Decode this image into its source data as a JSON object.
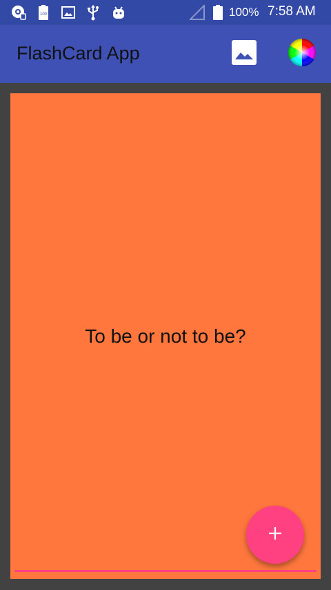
{
  "status_bar": {
    "battery_percent": "100%",
    "time": "7:58 AM",
    "icons": [
      "sync-music-icon",
      "battery-saver-icon",
      "image-notification-icon",
      "usb-icon",
      "android-debug-icon",
      "signal-icon",
      "battery-icon"
    ]
  },
  "app_bar": {
    "title": "FlashCard App",
    "actions": [
      "image-icon",
      "color-wheel-icon"
    ]
  },
  "card": {
    "text": "To be or not to be?"
  },
  "fab": {
    "icon": "plus-icon",
    "label": "+"
  },
  "colors": {
    "status_bar": "#3349a6",
    "app_bar": "#3f51b5",
    "background": "#424242",
    "card": "#ff773d",
    "accent": "#ff4081"
  },
  "mini_battery_label": "100"
}
